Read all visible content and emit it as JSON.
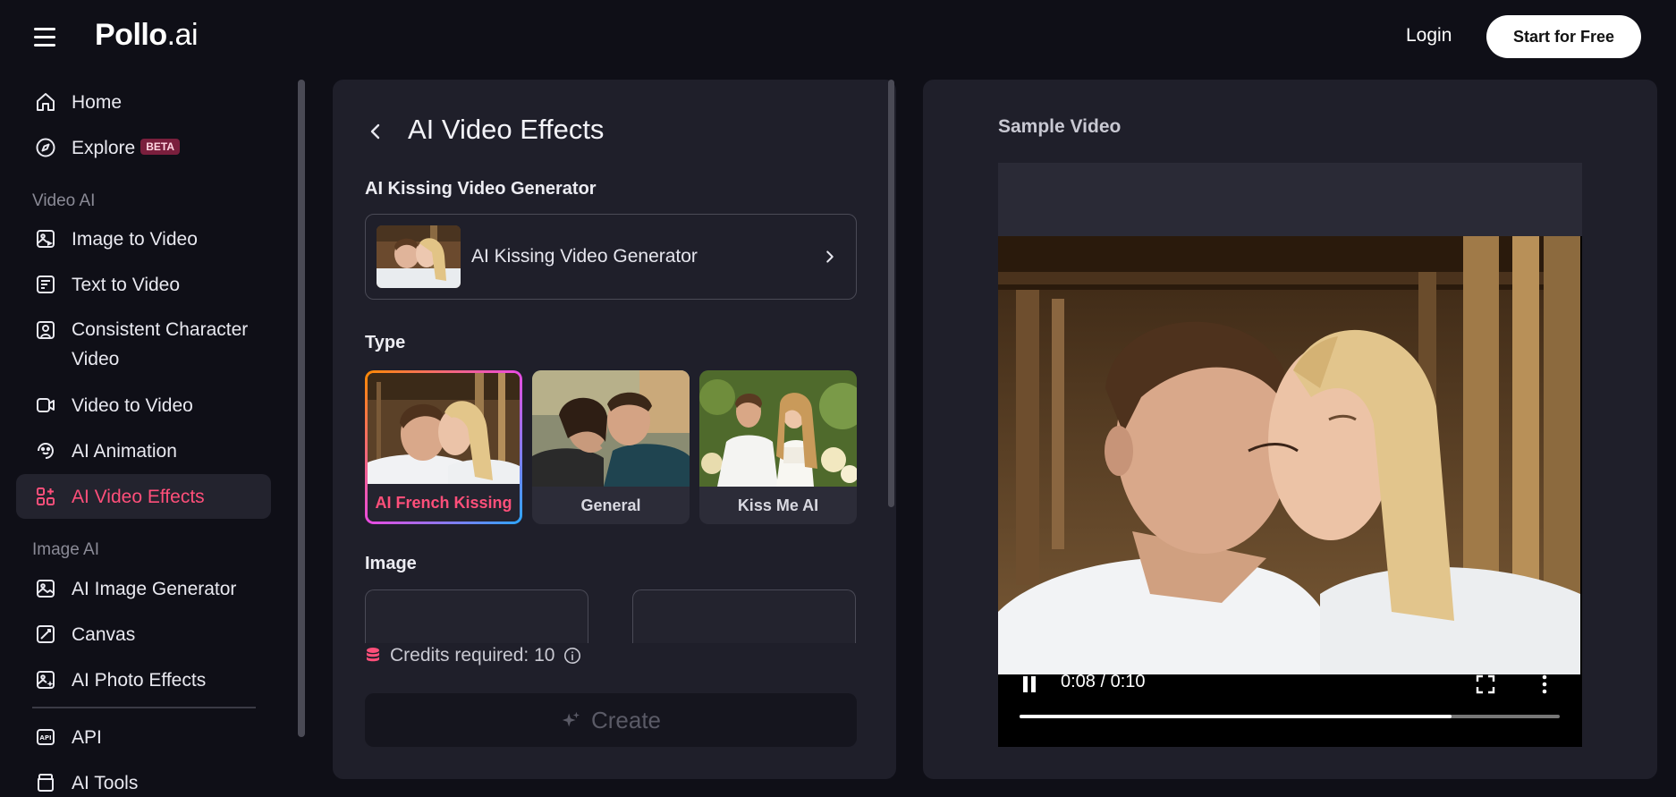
{
  "header": {
    "logo_main": "Pollo",
    "logo_suffix": ".ai",
    "login_label": "Login",
    "start_label": "Start for Free"
  },
  "sidebar": {
    "items": [
      {
        "label": "Home",
        "icon": "home-icon"
      },
      {
        "label": "Explore",
        "icon": "compass-icon",
        "badge": "BETA"
      },
      {
        "label": "Image to Video",
        "icon": "image-video-icon"
      },
      {
        "label": "Text to Video",
        "icon": "text-video-icon"
      },
      {
        "label": "Consistent Character Video",
        "icon": "character-video-icon"
      },
      {
        "label": "Video to Video",
        "icon": "video-video-icon"
      },
      {
        "label": "AI Animation",
        "icon": "animation-icon"
      },
      {
        "label": "AI Video Effects",
        "icon": "video-effects-icon"
      },
      {
        "label": "AI Image Generator",
        "icon": "image-generator-icon"
      },
      {
        "label": "Canvas",
        "icon": "canvas-icon"
      },
      {
        "label": "AI Photo Effects",
        "icon": "photo-effects-icon"
      },
      {
        "label": "API",
        "icon": "api-icon"
      },
      {
        "label": "AI Tools",
        "icon": "tools-icon"
      }
    ],
    "sections": {
      "video": "Video AI",
      "image": "Image AI"
    },
    "active_item": "AI Video Effects"
  },
  "panel": {
    "title": "AI Video Effects",
    "generator_label": "AI Kissing Video Generator",
    "generator_value": "AI Kissing Video Generator",
    "type_label": "Type",
    "types": [
      {
        "label": "AI French Kissing",
        "selected": true
      },
      {
        "label": "General",
        "selected": false
      },
      {
        "label": "Kiss Me AI",
        "selected": false
      }
    ],
    "image_label": "Image",
    "credits_text": "Credits required: 10",
    "create_label": "Create"
  },
  "preview": {
    "label": "Sample Video",
    "time": "0:08 / 0:10",
    "progress": 0.8
  },
  "colors": {
    "accent": "#ff4f7a",
    "background": "#0f0f17",
    "panel": "#1f1f2a"
  }
}
